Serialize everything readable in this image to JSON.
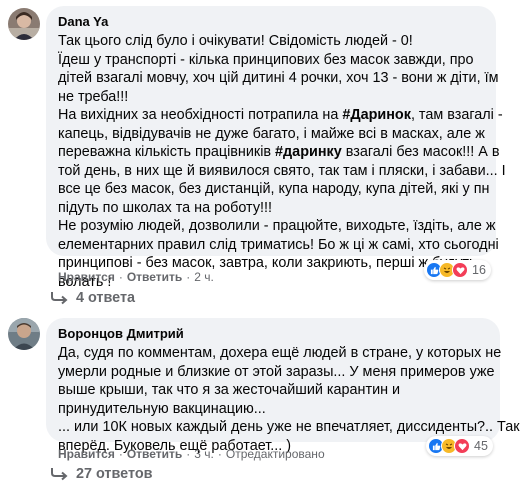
{
  "comments": [
    {
      "author": "Dana Ya",
      "lines": [
        [
          {
            "t": "Так цього слід було і очікувати! Свідомість людей - 0!"
          }
        ],
        [
          {
            "t": "Їдеш у транспорті - кілька принципових без масок завжди, про"
          }
        ],
        [
          {
            "t": "дітей взагалі мовчу, хоч цій дитині 4 рочки, хоч 13 - вони ж діти, їм"
          }
        ],
        [
          {
            "t": "не треба!!!"
          }
        ],
        [
          {
            "t": "На вихідних за необхідності потрапила на "
          },
          {
            "t": "#Даринок",
            "tag": true
          },
          {
            "t": ", там взагалі -"
          }
        ],
        [
          {
            "t": "капець, відвідувачів не дуже багато, і майже всі в масках, але ж"
          }
        ],
        [
          {
            "t": "переважна кількість працівників "
          },
          {
            "t": "#даринку",
            "tag": true
          },
          {
            "t": " взагалі без масок!!! А в"
          }
        ],
        [
          {
            "t": "той день, в них ще й виявилося свято, так там і пляски, і забави... І"
          }
        ],
        [
          {
            "t": "все це без масок, без дистанцій, купа народу, купа дітей, які у пн"
          }
        ],
        [
          {
            "t": "підуть по школах та на роботу!!!"
          }
        ],
        [
          {
            "t": "Не розумію людей, дозволили - працюйте, виходьте, їздіть, але ж"
          }
        ],
        [
          {
            "t": "елементарних правил слід триматись! Бо ж ці ж самі, хто сьогодні"
          }
        ],
        [
          {
            "t": "принципові - без масок, завтра, коли закриють, перші ж будуть"
          }
        ],
        [
          {
            "t": "волать !"
          }
        ]
      ],
      "reaction_count": "16",
      "like_label": "Нравится",
      "reply_label": "Ответить",
      "time": "2 ч.",
      "edited": "",
      "replies_label": "4 ответа"
    },
    {
      "author": "Воронцов Дмитрий",
      "lines": [
        [
          {
            "t": "Да, судя по комментам, дохера ещё людей в стране, у которых не"
          }
        ],
        [
          {
            "t": "умерли родные и близкие от этой заразы... У меня примеров уже"
          }
        ],
        [
          {
            "t": "выше крыши, так что я за жесточайший карантин и"
          }
        ],
        [
          {
            "t": "принудительную вакцинацию..."
          }
        ],
        [
          {
            "t": "... или 10К новых каждый день уже не впечатляет, диссиденты?.. Так"
          }
        ],
        [
          {
            "t": "вперёд. Буковель ещё работает... )"
          }
        ]
      ],
      "reaction_count": "45",
      "like_label": "Нравится",
      "reply_label": "Ответить",
      "time": "3 ч.",
      "edited": "Отредактировано",
      "replies_label": "27 ответов"
    }
  ],
  "colors": {
    "bubble": "#f0f2f5",
    "meta_text": "#65676b",
    "like_blue": "#1877f2",
    "love_red": "#f33e58",
    "haha_yellow": "#f7b928"
  },
  "icons": {
    "like": "thumbs-up-icon",
    "love": "heart-icon",
    "haha": "laughing-face-icon",
    "reply": "reply-arrow-icon"
  }
}
